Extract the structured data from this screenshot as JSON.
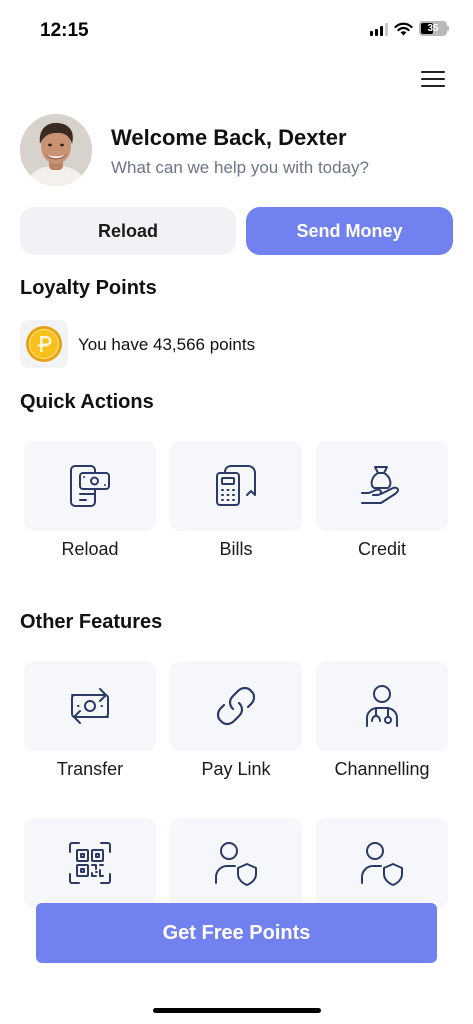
{
  "status_bar": {
    "time": "12:15",
    "battery_level": "35"
  },
  "header": {
    "title": "Welcome Back, Dexter",
    "subtitle": "What can we help you with today?"
  },
  "actions": {
    "reload_label": "Reload",
    "send_money_label": "Send Money"
  },
  "loyalty": {
    "title": "Loyalty Points",
    "points_text": "You have 43,566 points"
  },
  "quick_actions": {
    "title": "Quick Actions",
    "items": [
      {
        "label": "Reload",
        "icon": "phone-cash-icon"
      },
      {
        "label": "Bills",
        "icon": "bill-receipt-icon"
      },
      {
        "label": "Credit",
        "icon": "money-bag-hand-icon"
      }
    ]
  },
  "other_features": {
    "title": "Other Features",
    "items": [
      {
        "label": "Transfer",
        "icon": "transfer-money-icon"
      },
      {
        "label": "Pay Link",
        "icon": "link-icon"
      },
      {
        "label": "Channelling",
        "icon": "doctor-icon"
      },
      {
        "label": "",
        "icon": "qr-code-icon"
      },
      {
        "label": "",
        "icon": "user-shield-icon"
      },
      {
        "label": "",
        "icon": "user-shield-icon"
      }
    ]
  },
  "cta": {
    "label": "Get Free Points"
  },
  "colors": {
    "accent": "#7181f0",
    "icon_stroke": "#2b3a67",
    "subtitle": "#6c7686",
    "tile_bg": "#f6f7fa"
  }
}
